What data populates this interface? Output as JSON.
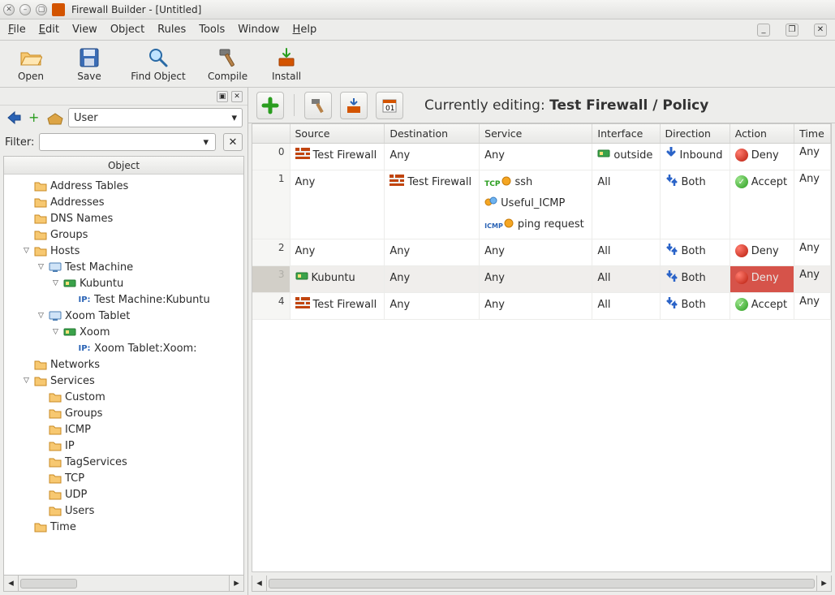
{
  "titlebar": {
    "title": "Firewall Builder - [Untitled]"
  },
  "menubar": {
    "file": "File",
    "edit": "Edit",
    "view": "View",
    "object": "Object",
    "rules": "Rules",
    "tools": "Tools",
    "window": "Window",
    "help": "Help"
  },
  "toolbar": {
    "open": "Open",
    "save": "Save",
    "find": "Find Object",
    "compile": "Compile",
    "install": "Install"
  },
  "left": {
    "library": "User",
    "filter_label": "Filter:",
    "filter_value": "",
    "tree_header": "Object",
    "tree": [
      {
        "indent": 1,
        "tw": "",
        "icon": "folder",
        "label": "Address Tables"
      },
      {
        "indent": 1,
        "tw": "",
        "icon": "folder",
        "label": "Addresses"
      },
      {
        "indent": 1,
        "tw": "",
        "icon": "folder",
        "label": "DNS Names"
      },
      {
        "indent": 1,
        "tw": "",
        "icon": "folder",
        "label": "Groups"
      },
      {
        "indent": 1,
        "tw": "open",
        "icon": "folder",
        "label": "Hosts"
      },
      {
        "indent": 2,
        "tw": "open",
        "icon": "host",
        "label": "Test Machine"
      },
      {
        "indent": 3,
        "tw": "open",
        "icon": "nic",
        "label": "Kubuntu"
      },
      {
        "indent": 4,
        "tw": "",
        "icon": "ip",
        "label": "Test Machine:Kubuntu"
      },
      {
        "indent": 2,
        "tw": "open",
        "icon": "host",
        "label": "Xoom Tablet"
      },
      {
        "indent": 3,
        "tw": "open",
        "icon": "nic",
        "label": "Xoom"
      },
      {
        "indent": 4,
        "tw": "",
        "icon": "ip",
        "label": "Xoom Tablet:Xoom:"
      },
      {
        "indent": 1,
        "tw": "",
        "icon": "folder",
        "label": "Networks"
      },
      {
        "indent": 1,
        "tw": "open",
        "icon": "folder",
        "label": "Services"
      },
      {
        "indent": 2,
        "tw": "",
        "icon": "folder",
        "label": "Custom"
      },
      {
        "indent": 2,
        "tw": "",
        "icon": "folder",
        "label": "Groups"
      },
      {
        "indent": 2,
        "tw": "",
        "icon": "folder",
        "label": "ICMP"
      },
      {
        "indent": 2,
        "tw": "",
        "icon": "folder",
        "label": "IP"
      },
      {
        "indent": 2,
        "tw": "",
        "icon": "folder",
        "label": "TagServices"
      },
      {
        "indent": 2,
        "tw": "",
        "icon": "folder",
        "label": "TCP"
      },
      {
        "indent": 2,
        "tw": "",
        "icon": "folder",
        "label": "UDP"
      },
      {
        "indent": 2,
        "tw": "",
        "icon": "folder",
        "label": "Users"
      },
      {
        "indent": 1,
        "tw": "",
        "icon": "folder",
        "label": "Time"
      }
    ]
  },
  "right": {
    "editing_prefix": "Currently editing: ",
    "editing_path": "Test Firewall / Policy",
    "columns": [
      "",
      "Source",
      "Destination",
      "Service",
      "Interface",
      "Direction",
      "Action",
      "Time"
    ],
    "rows": [
      {
        "idx": "0",
        "source": [
          {
            "icon": "fw",
            "t": "Test Firewall"
          }
        ],
        "dest": [
          {
            "t": "Any"
          }
        ],
        "service": [
          {
            "t": "Any"
          }
        ],
        "iface": [
          {
            "icon": "nic",
            "t": "outside"
          }
        ],
        "dir": {
          "icon": "in",
          "t": "Inbound"
        },
        "action": {
          "kind": "deny",
          "t": "Deny"
        },
        "time": "Any"
      },
      {
        "idx": "1",
        "source": [
          {
            "t": "Any"
          }
        ],
        "dest": [
          {
            "icon": "fw",
            "t": "Test Firewall"
          }
        ],
        "service": [
          {
            "icon": "tcp",
            "t": "ssh"
          },
          {
            "icon": "grp",
            "t": "Useful_ICMP"
          },
          {
            "icon": "icmp",
            "t": "ping request"
          }
        ],
        "iface": [
          {
            "t": "All"
          }
        ],
        "dir": {
          "icon": "both",
          "t": "Both"
        },
        "action": {
          "kind": "accept",
          "t": "Accept"
        },
        "time": "Any"
      },
      {
        "idx": "2",
        "source": [
          {
            "t": "Any"
          }
        ],
        "dest": [
          {
            "t": "Any"
          }
        ],
        "service": [
          {
            "t": "Any"
          }
        ],
        "iface": [
          {
            "t": "All"
          }
        ],
        "dir": {
          "icon": "both",
          "t": "Both"
        },
        "action": {
          "kind": "deny",
          "t": "Deny"
        },
        "time": "Any"
      },
      {
        "idx": "3",
        "sel": true,
        "source": [
          {
            "icon": "nic",
            "t": "Kubuntu"
          }
        ],
        "dest": [
          {
            "t": "Any"
          }
        ],
        "service": [
          {
            "t": "Any"
          }
        ],
        "iface": [
          {
            "t": "All"
          }
        ],
        "dir": {
          "icon": "both",
          "t": "Both"
        },
        "action": {
          "kind": "deny",
          "t": "Deny",
          "sel": true
        },
        "time": "Any"
      },
      {
        "idx": "4",
        "source": [
          {
            "icon": "fw",
            "t": "Test Firewall"
          }
        ],
        "dest": [
          {
            "t": "Any"
          }
        ],
        "service": [
          {
            "t": "Any"
          }
        ],
        "iface": [
          {
            "t": "All"
          }
        ],
        "dir": {
          "icon": "both",
          "t": "Both"
        },
        "action": {
          "kind": "accept",
          "t": "Accept"
        },
        "time": "Any"
      }
    ]
  }
}
